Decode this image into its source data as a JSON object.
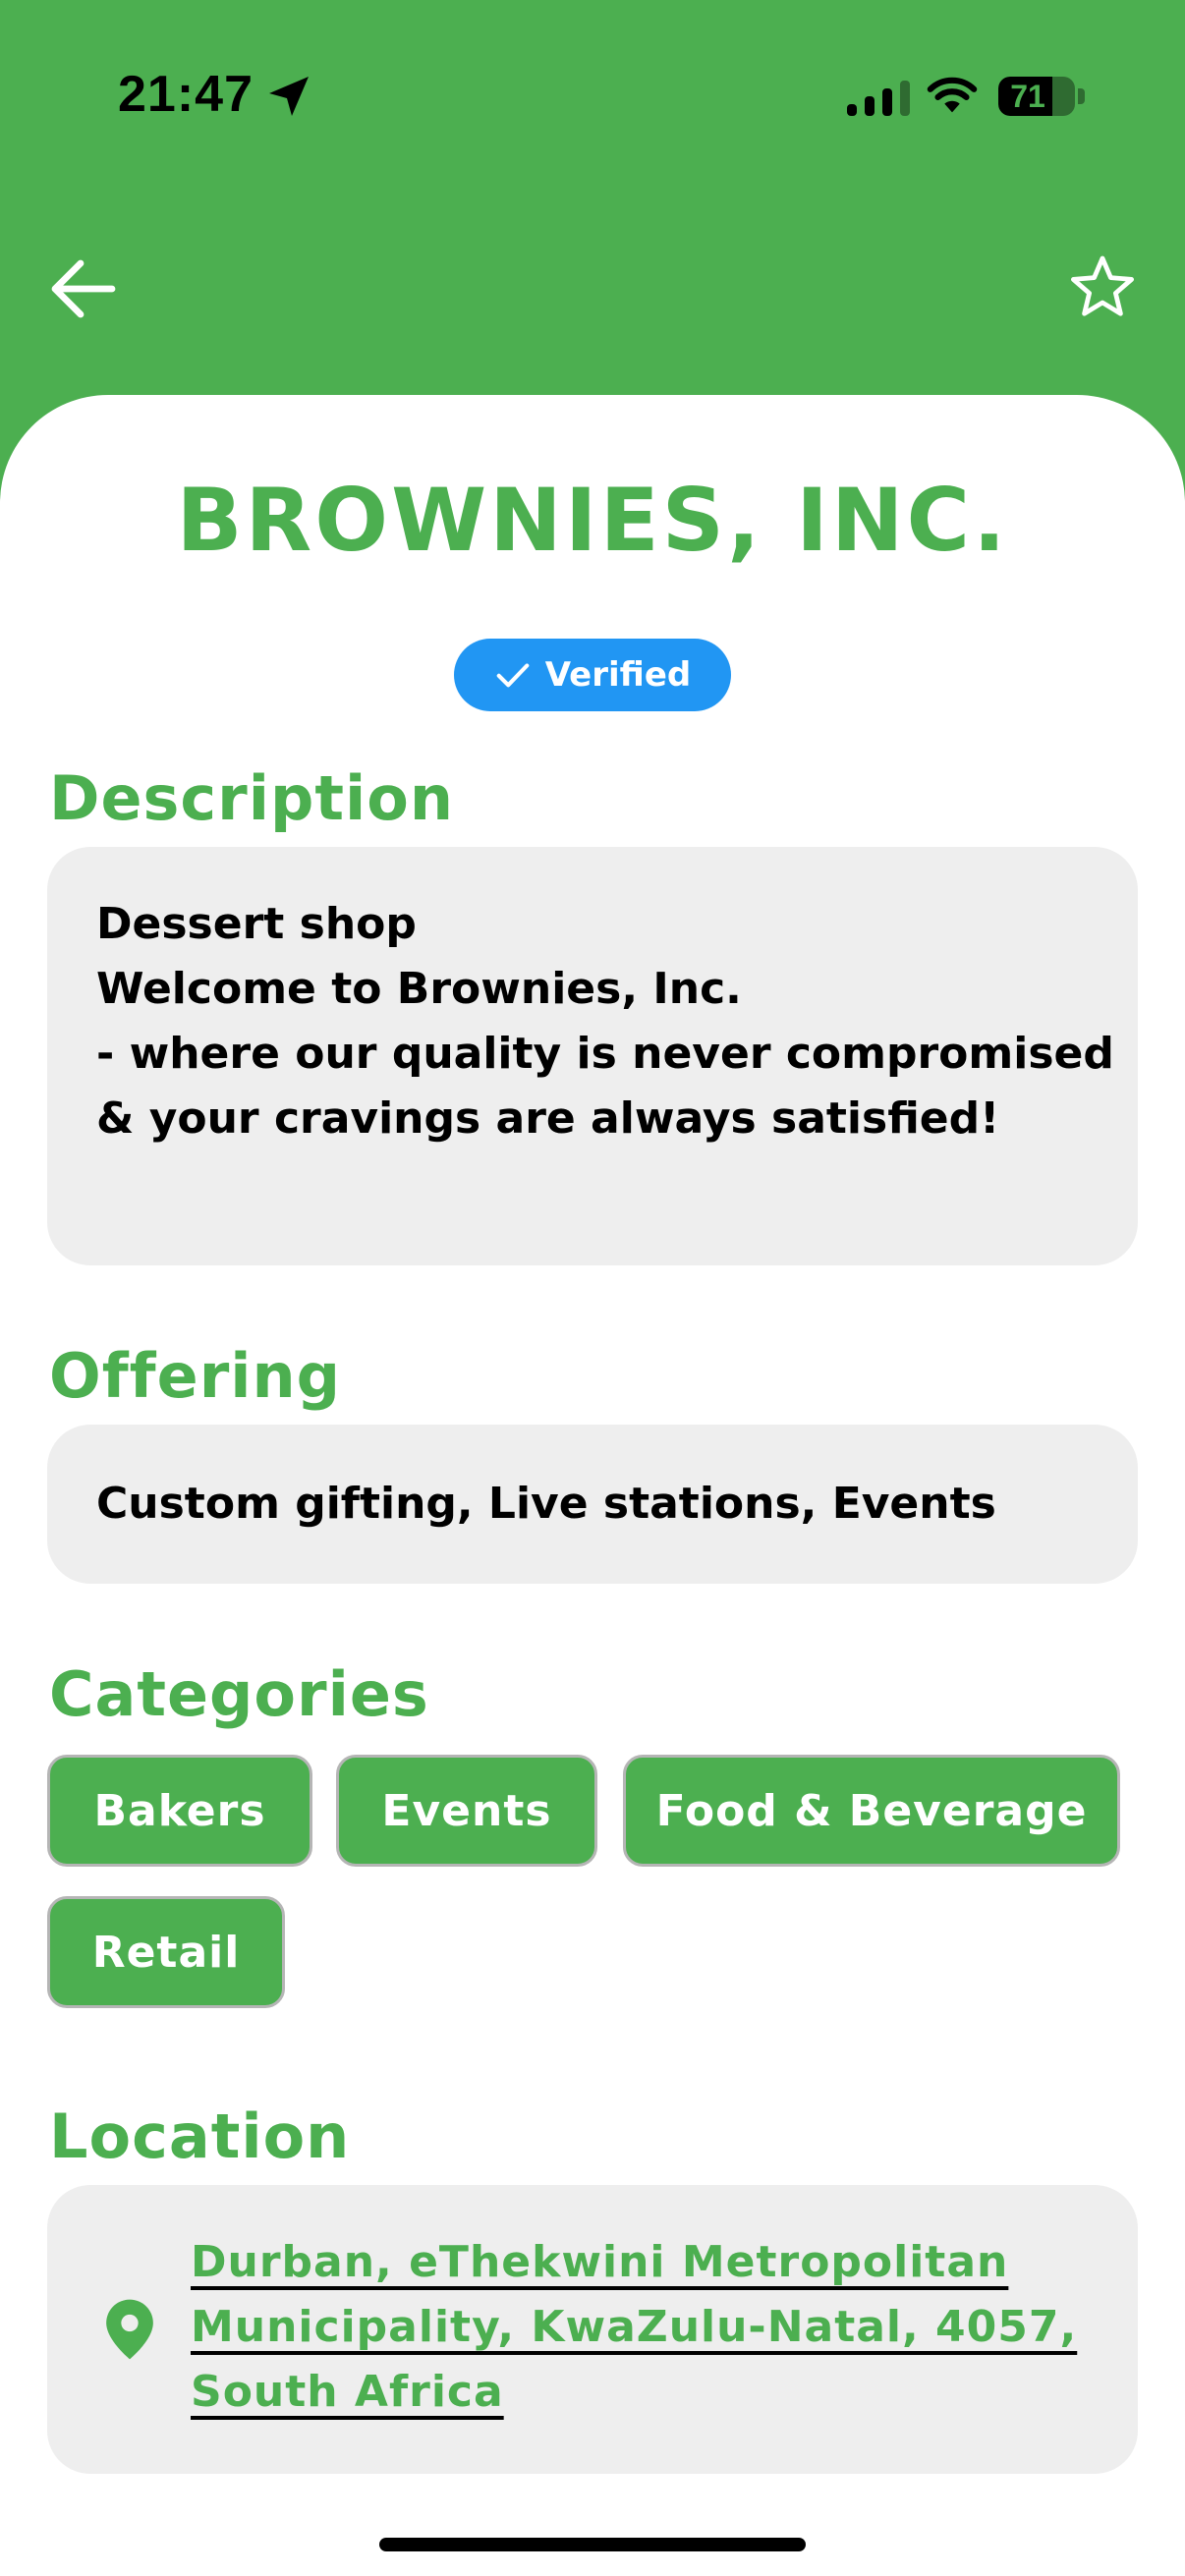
{
  "status_bar": {
    "time": "21:47",
    "battery": "71",
    "battery_level": 0.71,
    "icons": [
      "location-arrow-icon",
      "signal-icon",
      "wifi-icon",
      "battery-icon"
    ]
  },
  "header": {
    "back_icon": "arrow-left-icon",
    "favorite_icon": "star-outline-icon"
  },
  "business": {
    "name": "BROWNIES, INC.",
    "verified_label": "Verified"
  },
  "description": {
    "title": "Description",
    "text": "Dessert shop\nWelcome to Brownies, Inc.\n- where our quality is never compromised & your cravings are always satisfied!"
  },
  "offering": {
    "title": "Offering",
    "text": "Custom gifting, Live stations, Events"
  },
  "categories": {
    "title": "Categories",
    "items": [
      "Bakers",
      "Events",
      "Food & Beverage",
      "Retail"
    ]
  },
  "location": {
    "title": "Location",
    "address": "Durban, eThekwini Metropolitan Municipality, KwaZulu-Natal, 4057, South Africa"
  },
  "colors": {
    "brand_green": "#4caf50",
    "verified_blue": "#2196f3",
    "box_gray": "#eeeeee"
  }
}
